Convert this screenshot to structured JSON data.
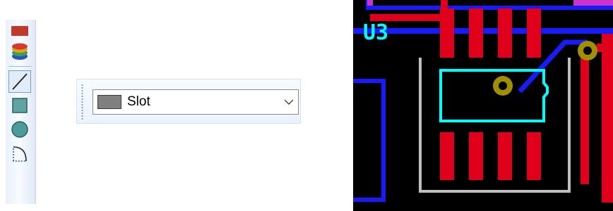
{
  "palette": {
    "tools": [
      {
        "id": "layer-color",
        "icon": "color-square-icon",
        "color": "#c0392b"
      },
      {
        "id": "layers",
        "icon": "layers-stack-icon"
      },
      {
        "id": "line",
        "icon": "line-icon",
        "active": true
      },
      {
        "id": "rectangle",
        "icon": "rectangle-icon",
        "color": "#5fa3a3"
      },
      {
        "id": "circle",
        "icon": "circle-icon",
        "color": "#4b9b9b"
      },
      {
        "id": "arc",
        "icon": "arc-icon"
      }
    ]
  },
  "layer_combo": {
    "selected": "Slot",
    "swatch_color": "#808080"
  },
  "pcb": {
    "designator": "U3",
    "colors": {
      "background": "#000000",
      "top_copper": "#e0001b",
      "bottom_copper": "#1a1aff",
      "silkscreen": "#bfbfbf",
      "selection": "#00ffff",
      "via": "#a09000",
      "keepout": "#cc33cc"
    }
  }
}
